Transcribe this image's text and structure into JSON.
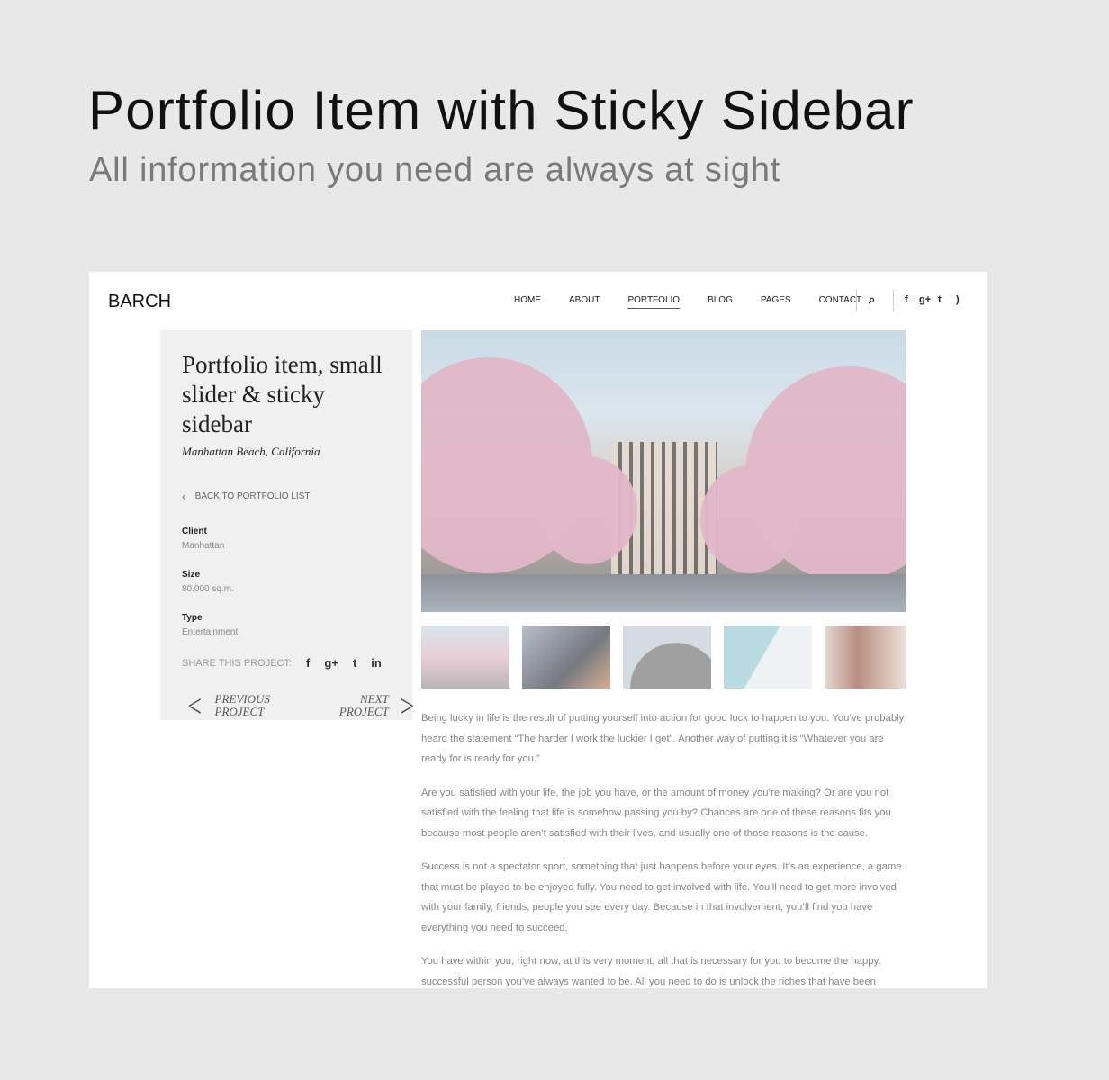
{
  "hero": {
    "title": "Portfolio Item with Sticky Sidebar",
    "subtitle": "All information you need are always at sight"
  },
  "site": {
    "logo": "BARCH",
    "nav": [
      {
        "label": "HOME"
      },
      {
        "label": "ABOUT"
      },
      {
        "label": "PORTFOLIO",
        "active": true
      },
      {
        "label": "BLOG"
      },
      {
        "label": "PAGES"
      },
      {
        "label": "CONTACT"
      }
    ],
    "header_icons": [
      "search-icon",
      "facebook-icon",
      "google-plus-icon",
      "twitter-icon",
      "rss-icon"
    ]
  },
  "sidebar": {
    "title": "Portfolio item, small slider & sticky sidebar",
    "location": "Manhattan Beach, California",
    "back_label": "BACK TO PORTFOLIO LIST",
    "meta": [
      {
        "label": "Client",
        "value": "Manhattan"
      },
      {
        "label": "Size",
        "value": "80.000 sq.m."
      },
      {
        "label": "Type",
        "value": "Entertainment"
      }
    ],
    "share_label": "SHARE THIS PROJECT:",
    "share_icons": [
      "facebook-icon",
      "google-plus-icon",
      "twitter-icon",
      "linkedin-icon"
    ],
    "prev": {
      "line1": "PREVIOUS",
      "line2": "PROJECT"
    },
    "next": {
      "line1": "NEXT",
      "line2": "PROJECT"
    }
  },
  "gallery": {
    "thumb_count": 5
  },
  "content": {
    "paragraphs": [
      "Being lucky in life is the result of putting yourself into action for good luck to happen to you. You’ve probably heard the statement “The harder I work the luckier I get”. Another way of putting it is “Whatever you are ready for is ready for you.”",
      "Are you satisfied with your life, the job you have, or the amount of money you’re making? Or are you not satisfied with the feeling that life is somehow passing you by? Chances are one of these reasons fits you because most people aren’t satisfied with their lives, and usually one of those reasons is the cause.",
      "Success is not a spectator sport, something that just happens before your eyes. It’s an experience, a game that must be played to be enjoyed fully. You need to get involved with life. You’ll need to get more involved with your family, friends, people you see every day. Because in that involvement, you’ll find you have everything you need to succeed.",
      "You have within you, right now, at this very moment, all that is necessary for you to become the happy, successful person you’ve always wanted to be. All you need to do is unlock the riches that have been"
    ]
  }
}
